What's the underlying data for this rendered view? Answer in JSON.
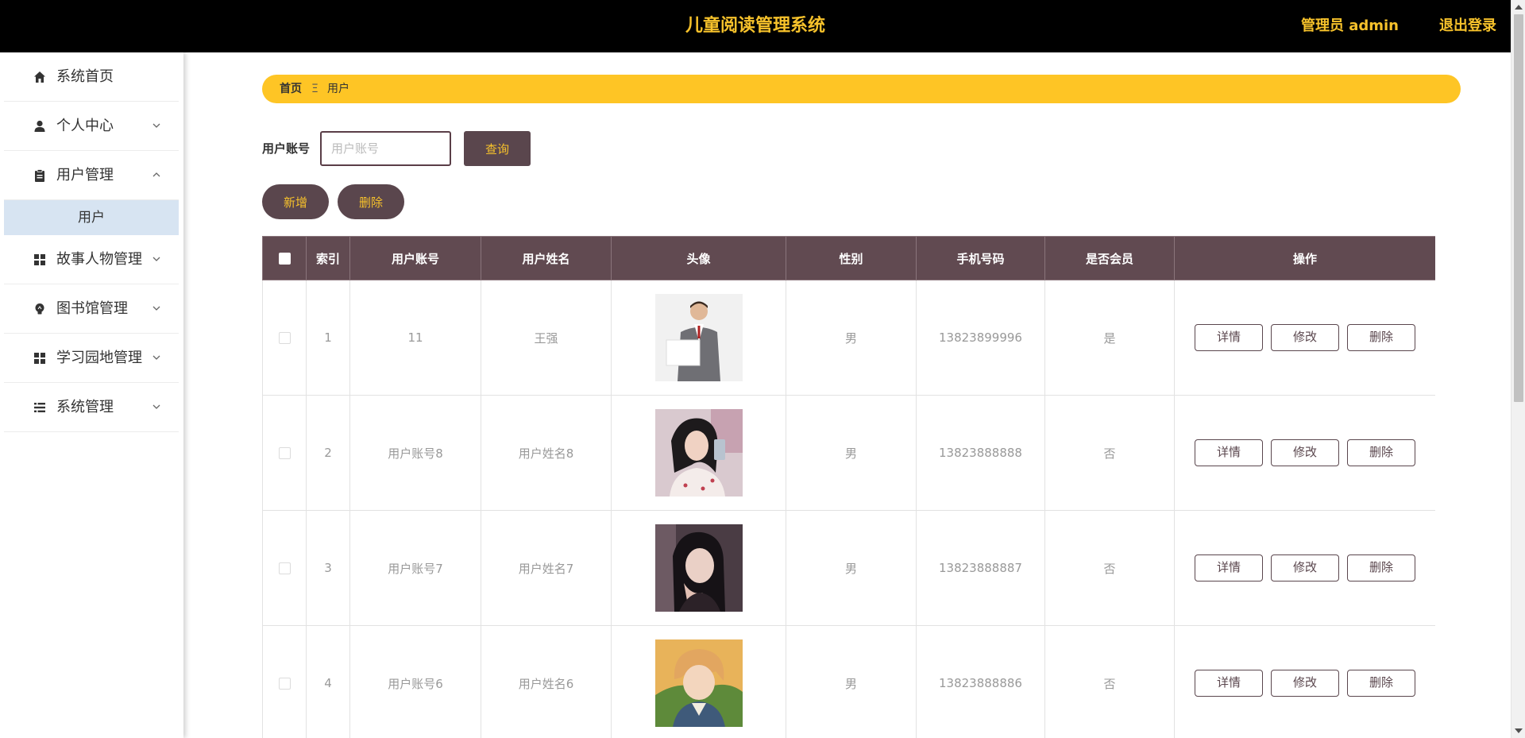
{
  "header": {
    "title": "儿童阅读管理系统",
    "admin_label": "管理员 admin",
    "logout_label": "退出登录"
  },
  "colors": {
    "header_bg": "#000000",
    "accent_yellow": "#f7c22b",
    "breadcrumb_bg": "#fec525",
    "primary_dark": "#5a464d",
    "table_header_bg": "#614a51",
    "submenu_active_bg": "#d7e4f2"
  },
  "sidebar": {
    "items": [
      {
        "label": "系统首页",
        "icon": "home-icon"
      },
      {
        "label": "个人中心",
        "icon": "person-icon",
        "chevron": "down"
      },
      {
        "label": "用户管理",
        "icon": "clipboard-icon",
        "chevron": "up"
      },
      {
        "label": "故事人物管理",
        "icon": "grid-icon",
        "chevron": "down"
      },
      {
        "label": "图书馆管理",
        "icon": "bulb-icon",
        "chevron": "down"
      },
      {
        "label": "学习园地管理",
        "icon": "grid-icon",
        "chevron": "down"
      },
      {
        "label": "系统管理",
        "icon": "list-icon",
        "chevron": "down"
      }
    ],
    "submenu": {
      "label": "用户"
    }
  },
  "breadcrumb": {
    "home": "首页",
    "separator": "Ξ",
    "current": "用户"
  },
  "search": {
    "label": "用户账号",
    "placeholder": "用户账号",
    "query_label": "查询"
  },
  "actions": {
    "add_label": "新增",
    "delete_label": "删除"
  },
  "table": {
    "headers": [
      "索引",
      "用户账号",
      "用户姓名",
      "头像",
      "性别",
      "手机号码",
      "是否会员",
      "操作"
    ],
    "rows": [
      {
        "index": "1",
        "account": "11",
        "name": "王强",
        "avatar": "man-in-suit-photo",
        "gender": "男",
        "phone": "13823899996",
        "member": "是"
      },
      {
        "index": "2",
        "account": "用户账号8",
        "name": "用户姓名8",
        "avatar": "girl-selfie-photo",
        "gender": "男",
        "phone": "13823888888",
        "member": "否"
      },
      {
        "index": "3",
        "account": "用户账号7",
        "name": "用户姓名7",
        "avatar": "girl-wink-photo",
        "gender": "男",
        "phone": "13823888887",
        "member": "否"
      },
      {
        "index": "4",
        "account": "用户账号6",
        "name": "用户姓名6",
        "avatar": "anime-boy-illustration",
        "gender": "男",
        "phone": "13823888886",
        "member": "否"
      }
    ],
    "row_actions": {
      "detail": "详情",
      "edit": "修改",
      "delete": "删除"
    }
  }
}
